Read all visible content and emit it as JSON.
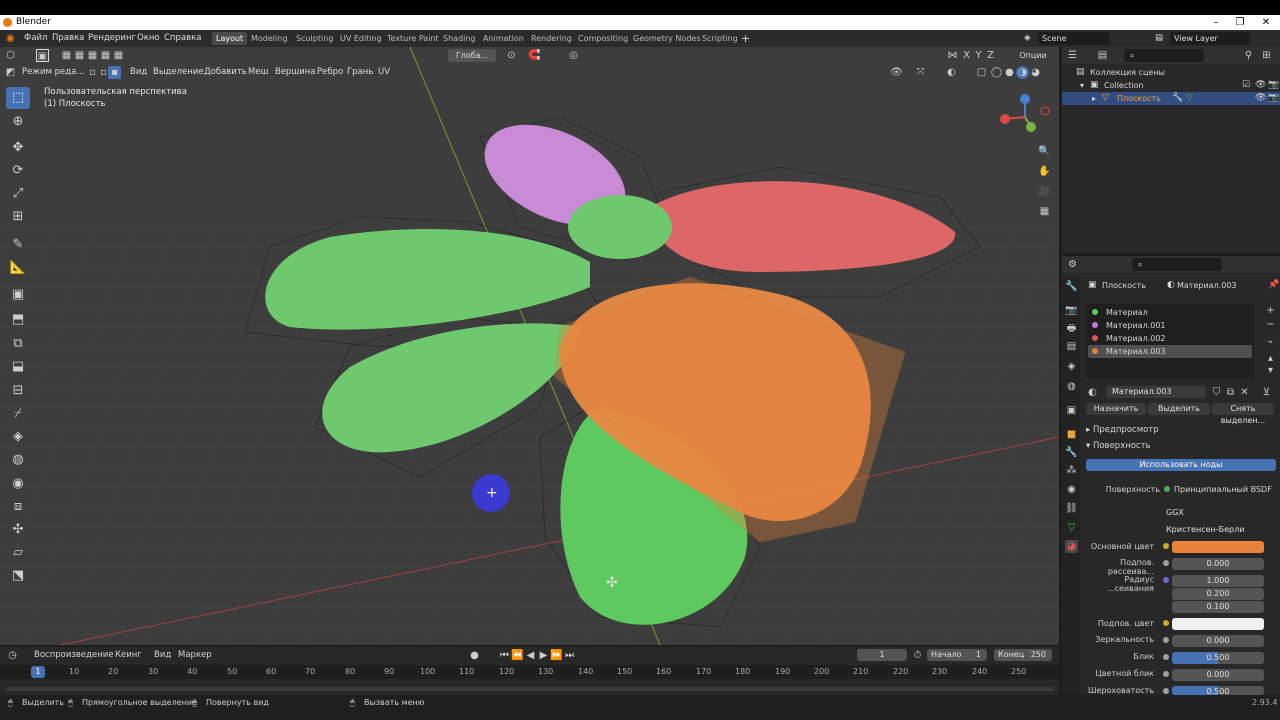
{
  "window": {
    "title": "Blender",
    "version": "2.93.4"
  },
  "menu": {
    "items": [
      "Файл",
      "Правка",
      "Рендеринг",
      "Окно",
      "Справка"
    ],
    "workspaces": [
      "Layout",
      "Modeling",
      "Sculpting",
      "UV Editing",
      "Texture Paint",
      "Shading",
      "Animation",
      "Rendering",
      "Compositing",
      "Geometry Nodes",
      "Scripting"
    ],
    "active_workspace": "Layout",
    "scene": "Scene",
    "view_layer": "View Layer"
  },
  "viewport": {
    "mode": "Режим реда...",
    "menus": [
      "Вид",
      "Выделение",
      "Добавить",
      "Меш",
      "Вершина",
      "Ребро",
      "Грань",
      "UV"
    ],
    "transform_orientation": "Глоба...",
    "options_label": "Опции",
    "view_name": "Пользовательская перспектива",
    "object_name": "(1) Плоскость",
    "axes": {
      "x": "X",
      "y": "Y",
      "z": "Z"
    }
  },
  "outliner": {
    "scene_collection": "Коллекция сцены",
    "collection": "Collection",
    "object": "Плоскость"
  },
  "properties": {
    "object": "Плоскость",
    "material_name": "Материал.003",
    "slots": [
      {
        "name": "Материал",
        "color": "#5ec95e"
      },
      {
        "name": "Материал.001",
        "color": "#c27ad6"
      },
      {
        "name": "Материал.002",
        "color": "#e05555"
      },
      {
        "name": "Материал.003",
        "color": "#e8823a"
      }
    ],
    "active_slot": 3,
    "assign": "Назначить",
    "select": "Выделить",
    "deselect": "Снять выделен...",
    "preview": "Предпросмотр",
    "surface_panel": "Поверхность",
    "use_nodes": "Использовать ноды",
    "surface_label": "Поверхность",
    "surface_value": "Принципиальный BSDF",
    "distribution": "GGX",
    "subsurface_method": "Кристенсен-Берли",
    "fields": [
      {
        "label": "Основной цвет",
        "type": "color",
        "color": "#e8823a"
      },
      {
        "label": "Подпов. рассеива...",
        "value": "0.000"
      },
      {
        "label": "Радиус ...сеивания",
        "value": "1.000",
        "extra": [
          "0.200",
          "0.100"
        ]
      },
      {
        "label": "Подпов. цвет",
        "type": "color",
        "color": "#f0f0f0"
      },
      {
        "label": "Зеркальность",
        "value": "0.000"
      },
      {
        "label": "Блик",
        "value": "0.500",
        "fill": 0.5
      },
      {
        "label": "Цветной блик",
        "value": "0.000"
      },
      {
        "label": "Шероховатость",
        "value": "0.500",
        "fill": 0.5
      }
    ]
  },
  "timeline": {
    "menus": [
      "Воспроизведение",
      "Кеинг",
      "Вид",
      "Маркер"
    ],
    "current_frame": "1",
    "start_label": "Начало",
    "start": "1",
    "end_label": "Конец",
    "end": "250",
    "ticks": [
      "10",
      "20",
      "30",
      "40",
      "50",
      "60",
      "70",
      "80",
      "90",
      "100",
      "110",
      "120",
      "130",
      "140",
      "150",
      "160",
      "170",
      "180",
      "190",
      "200",
      "210",
      "220",
      "230",
      "240",
      "250"
    ],
    "playhead": "1"
  },
  "status": {
    "select": "Выделить",
    "box_select": "Прямоугольное выделение",
    "rotate_view": "Повернуть вид",
    "call_menu": "Вызвать меню"
  }
}
